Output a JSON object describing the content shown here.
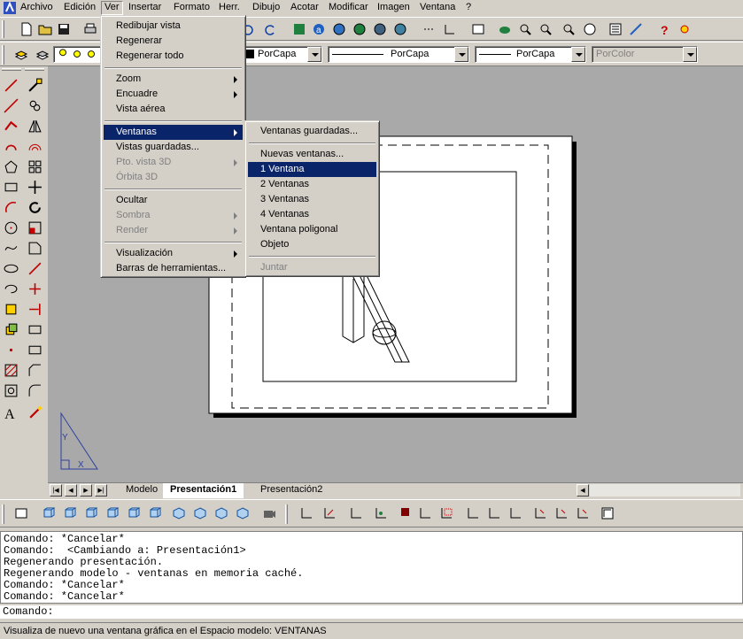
{
  "menubar": {
    "items": [
      "Archivo",
      "Edición",
      "Ver",
      "Insertar",
      "Formato",
      "Herr.",
      "Dibujo",
      "Acotar",
      "Modificar",
      "Imagen",
      "Ventana",
      "?"
    ]
  },
  "properties_toolbar": {
    "color_combo": "PorCapa",
    "linetype_combo": "PorCapa",
    "lineweight_combo": "PorCapa",
    "plotstyle_combo": "PorColor"
  },
  "ver_menu": {
    "items": [
      {
        "label": "Redibujar vista"
      },
      {
        "label": "Regenerar"
      },
      {
        "label": "Regenerar todo"
      },
      {
        "label": "Zoom"
      },
      {
        "label": "Encuadre"
      },
      {
        "label": "Vista aérea"
      },
      {
        "label": "Ventanas"
      },
      {
        "label": "Vistas guardadas..."
      },
      {
        "label": "Pto. vista 3D"
      },
      {
        "label": "Órbita 3D"
      },
      {
        "label": "Ocultar"
      },
      {
        "label": "Sombra"
      },
      {
        "label": "Render"
      },
      {
        "label": "Visualización"
      },
      {
        "label": "Barras de herramientas..."
      }
    ]
  },
  "ventanas_submenu": {
    "items": [
      {
        "label": "Ventanas guardadas..."
      },
      {
        "label": "Nuevas ventanas..."
      },
      {
        "label": "1 Ventana"
      },
      {
        "label": "2 Ventanas"
      },
      {
        "label": "3 Ventanas"
      },
      {
        "label": "4 Ventanas"
      },
      {
        "label": "Ventana poligonal"
      },
      {
        "label": "Objeto"
      },
      {
        "label": "Juntar"
      }
    ]
  },
  "tabs": [
    "Modelo",
    "Presentación1",
    "Presentación2"
  ],
  "command_history": [
    "Comando: *Cancelar*",
    "Comando:  <Cambiando a: Presentación1>",
    "Regenerando presentación.",
    "Regenerando modelo - ventanas en memoria caché.",
    "Comando: *Cancelar*",
    "Comando: *Cancelar*"
  ],
  "command_prompt": "Comando:",
  "status_text": "Visualiza de nuevo una ventana gráfica en el Espacio modelo: VENTANAS",
  "colors": {
    "highlight": "#0a246a",
    "face": "#d4d0c8",
    "canvas": "#a9a9a9"
  }
}
